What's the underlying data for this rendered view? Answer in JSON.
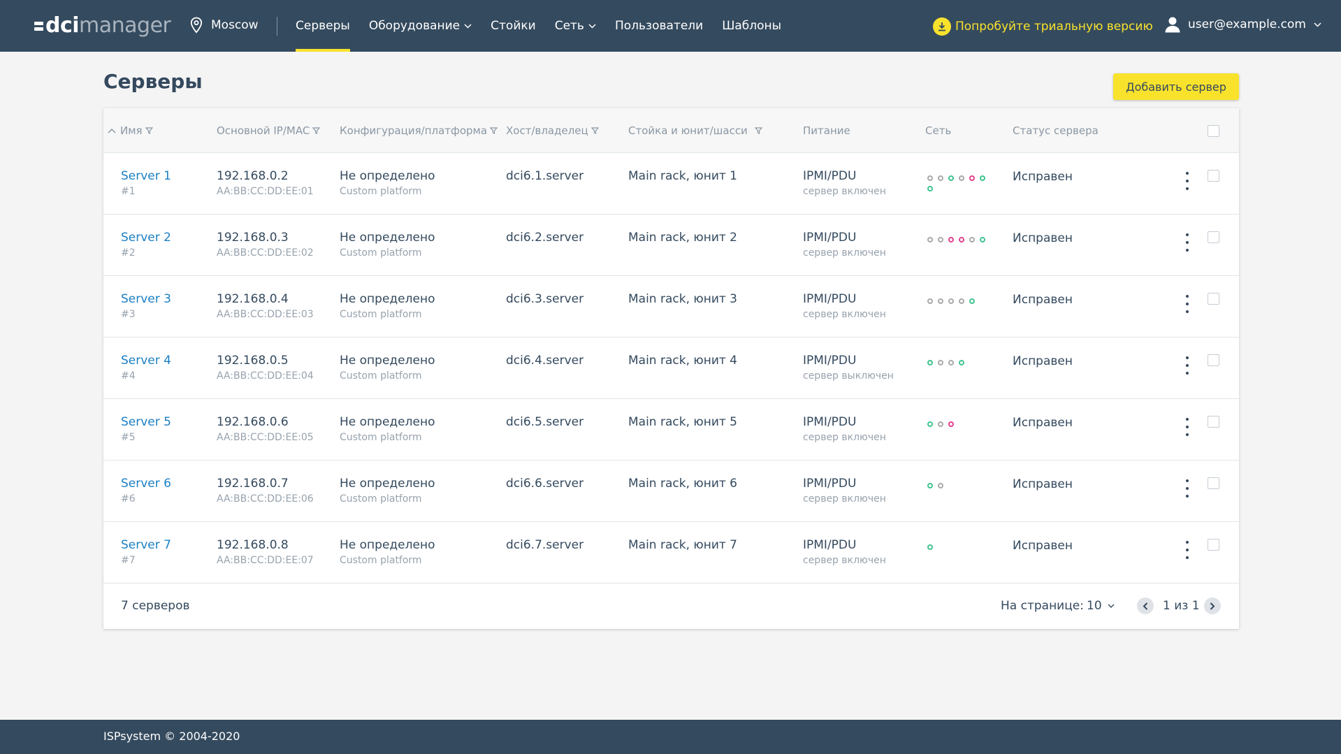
{
  "header": {
    "logo_dci": "dci",
    "logo_manager": "manager",
    "location": "Moscow",
    "nav": [
      {
        "label": "Серверы",
        "active": true,
        "dropdown": false
      },
      {
        "label": "Оборудование",
        "active": false,
        "dropdown": true
      },
      {
        "label": "Стойки",
        "active": false,
        "dropdown": false
      },
      {
        "label": "Сеть",
        "active": false,
        "dropdown": true
      },
      {
        "label": "Пользователи",
        "active": false,
        "dropdown": false
      },
      {
        "label": "Шаблоны",
        "active": false,
        "dropdown": false
      }
    ],
    "trial": "Попробуйте триальную версию",
    "user": "user@example.com"
  },
  "page": {
    "title": "Серверы",
    "add_button": "Добавить сервер"
  },
  "table": {
    "columns": [
      "Имя",
      "Основной IP/MAC",
      "Конфигурация/платформа",
      "Хост/владелец",
      "Стойка и юнит/шасси",
      "Питание",
      "Сеть",
      "Статус сервера"
    ],
    "rows": [
      {
        "name": "Server 1",
        "id": "#1",
        "ip": "192.168.0.2",
        "mac": "AA:BB:CC:DD:EE:01",
        "config": "Не определено",
        "platform": "Custom platform",
        "host": "dci6.1.server",
        "rack": "Main rack, юнит 1",
        "power": "IPMI/PDU",
        "power_state": "сервер включен",
        "network": [
          "grey",
          "grey",
          "green",
          "grey",
          "pink",
          "green",
          "green"
        ],
        "status": "Исправен"
      },
      {
        "name": "Server 2",
        "id": "#2",
        "ip": "192.168.0.3",
        "mac": "AA:BB:CC:DD:EE:02",
        "config": "Не определено",
        "platform": "Custom platform",
        "host": "dci6.2.server",
        "rack": "Main rack, юнит 2",
        "power": "IPMI/PDU",
        "power_state": "сервер включен",
        "network": [
          "grey",
          "grey",
          "pink",
          "pink",
          "grey",
          "green"
        ],
        "status": "Исправен"
      },
      {
        "name": "Server 3",
        "id": "#3",
        "ip": "192.168.0.4",
        "mac": "AA:BB:CC:DD:EE:03",
        "config": "Не определено",
        "platform": "Custom platform",
        "host": "dci6.3.server",
        "rack": "Main rack, юнит 3",
        "power": "IPMI/PDU",
        "power_state": "сервер включен",
        "network": [
          "grey",
          "grey",
          "grey",
          "grey",
          "green"
        ],
        "status": "Исправен"
      },
      {
        "name": "Server 4",
        "id": "#4",
        "ip": "192.168.0.5",
        "mac": "AA:BB:CC:DD:EE:04",
        "config": "Не определено",
        "platform": "Custom platform",
        "host": "dci6.4.server",
        "rack": "Main rack, юнит 4",
        "power": "IPMI/PDU",
        "power_state": "сервер выключен",
        "network": [
          "green",
          "grey",
          "grey",
          "green"
        ],
        "status": "Исправен"
      },
      {
        "name": "Server 5",
        "id": "#5",
        "ip": "192.168.0.6",
        "mac": "AA:BB:CC:DD:EE:05",
        "config": "Не определено",
        "platform": "Custom platform",
        "host": "dci6.5.server",
        "rack": "Main rack, юнит 5",
        "power": "IPMI/PDU",
        "power_state": "сервер включен",
        "network": [
          "green",
          "grey",
          "pink"
        ],
        "status": "Исправен"
      },
      {
        "name": "Server 6",
        "id": "#6",
        "ip": "192.168.0.7",
        "mac": "AA:BB:CC:DD:EE:06",
        "config": "Не определено",
        "platform": "Custom platform",
        "host": "dci6.6.server",
        "rack": "Main rack, юнит 6",
        "power": "IPMI/PDU",
        "power_state": "сервер включен",
        "network": [
          "green",
          "grey"
        ],
        "status": "Исправен"
      },
      {
        "name": "Server 7",
        "id": "#7",
        "ip": "192.168.0.8",
        "mac": "AA:BB:CC:DD:EE:07",
        "config": "Не определено",
        "platform": "Custom platform",
        "host": "dci6.7.server",
        "rack": "Main rack, юнит 7",
        "power": "IPMI/PDU",
        "power_state": "сервер включен",
        "network": [
          "green"
        ],
        "status": "Исправен"
      }
    ],
    "footer": {
      "count": "7 серверов",
      "per_page_label": "На странице:",
      "per_page_value": "10",
      "pagination": "1 из 1"
    }
  },
  "footer": {
    "copyright": "ISPsystem © 2004-2020"
  },
  "colors": {
    "header_bg": "#344a5e",
    "accent": "#f8e22c",
    "link": "#1a7fc4",
    "dot_green": "#3fc48f",
    "dot_pink": "#e4408e",
    "dot_grey": "#a9a9a9"
  }
}
